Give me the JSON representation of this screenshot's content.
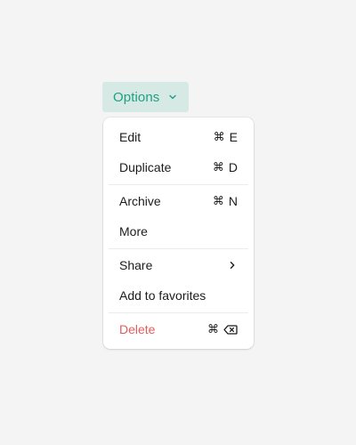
{
  "button": {
    "label": "Options",
    "icon": "chevron-down-icon",
    "color": "#1f9f83",
    "background": "#d6e9e5"
  },
  "menu": {
    "items": [
      {
        "label": "Edit",
        "shortcut_key": "E",
        "shortcut_modifier": "⌘"
      },
      {
        "label": "Duplicate",
        "shortcut_key": "D",
        "shortcut_modifier": "⌘"
      },
      {
        "label": "Archive",
        "shortcut_key": "N",
        "shortcut_modifier": "⌘"
      },
      {
        "label": "More"
      },
      {
        "label": "Share",
        "icon": "chevron-right-icon"
      },
      {
        "label": "Add to favorites"
      },
      {
        "label": "Delete",
        "shortcut_modifier": "⌘",
        "shortcut_icon": "backspace-icon",
        "color": "#e25d5d"
      }
    ]
  }
}
